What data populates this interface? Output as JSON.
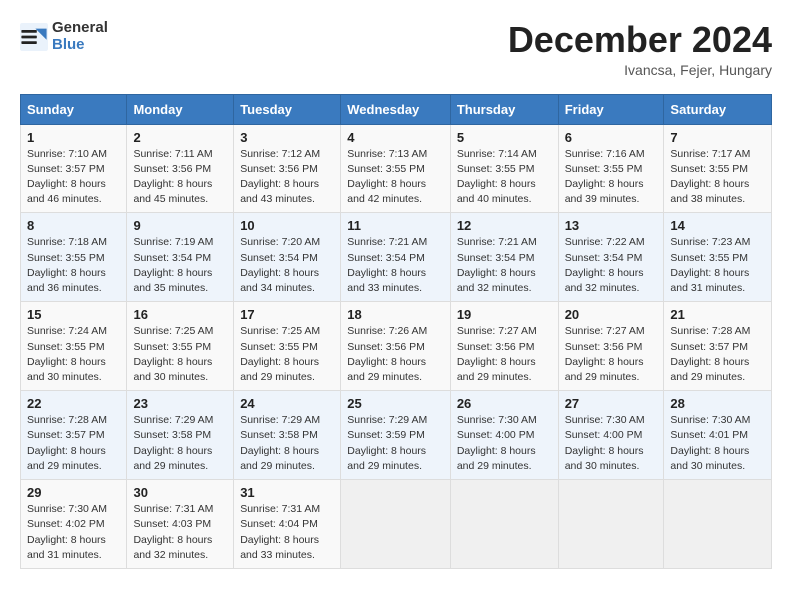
{
  "header": {
    "logo_line1": "General",
    "logo_line2": "Blue",
    "month": "December 2024",
    "location": "Ivancsa, Fejer, Hungary"
  },
  "columns": [
    "Sunday",
    "Monday",
    "Tuesday",
    "Wednesday",
    "Thursday",
    "Friday",
    "Saturday"
  ],
  "weeks": [
    [
      {
        "day": "1",
        "rise": "Sunrise: 7:10 AM",
        "set": "Sunset: 3:57 PM",
        "daylight": "Daylight: 8 hours and 46 minutes."
      },
      {
        "day": "2",
        "rise": "Sunrise: 7:11 AM",
        "set": "Sunset: 3:56 PM",
        "daylight": "Daylight: 8 hours and 45 minutes."
      },
      {
        "day": "3",
        "rise": "Sunrise: 7:12 AM",
        "set": "Sunset: 3:56 PM",
        "daylight": "Daylight: 8 hours and 43 minutes."
      },
      {
        "day": "4",
        "rise": "Sunrise: 7:13 AM",
        "set": "Sunset: 3:55 PM",
        "daylight": "Daylight: 8 hours and 42 minutes."
      },
      {
        "day": "5",
        "rise": "Sunrise: 7:14 AM",
        "set": "Sunset: 3:55 PM",
        "daylight": "Daylight: 8 hours and 40 minutes."
      },
      {
        "day": "6",
        "rise": "Sunrise: 7:16 AM",
        "set": "Sunset: 3:55 PM",
        "daylight": "Daylight: 8 hours and 39 minutes."
      },
      {
        "day": "7",
        "rise": "Sunrise: 7:17 AM",
        "set": "Sunset: 3:55 PM",
        "daylight": "Daylight: 8 hours and 38 minutes."
      }
    ],
    [
      {
        "day": "8",
        "rise": "Sunrise: 7:18 AM",
        "set": "Sunset: 3:55 PM",
        "daylight": "Daylight: 8 hours and 36 minutes."
      },
      {
        "day": "9",
        "rise": "Sunrise: 7:19 AM",
        "set": "Sunset: 3:54 PM",
        "daylight": "Daylight: 8 hours and 35 minutes."
      },
      {
        "day": "10",
        "rise": "Sunrise: 7:20 AM",
        "set": "Sunset: 3:54 PM",
        "daylight": "Daylight: 8 hours and 34 minutes."
      },
      {
        "day": "11",
        "rise": "Sunrise: 7:21 AM",
        "set": "Sunset: 3:54 PM",
        "daylight": "Daylight: 8 hours and 33 minutes."
      },
      {
        "day": "12",
        "rise": "Sunrise: 7:21 AM",
        "set": "Sunset: 3:54 PM",
        "daylight": "Daylight: 8 hours and 32 minutes."
      },
      {
        "day": "13",
        "rise": "Sunrise: 7:22 AM",
        "set": "Sunset: 3:54 PM",
        "daylight": "Daylight: 8 hours and 32 minutes."
      },
      {
        "day": "14",
        "rise": "Sunrise: 7:23 AM",
        "set": "Sunset: 3:55 PM",
        "daylight": "Daylight: 8 hours and 31 minutes."
      }
    ],
    [
      {
        "day": "15",
        "rise": "Sunrise: 7:24 AM",
        "set": "Sunset: 3:55 PM",
        "daylight": "Daylight: 8 hours and 30 minutes."
      },
      {
        "day": "16",
        "rise": "Sunrise: 7:25 AM",
        "set": "Sunset: 3:55 PM",
        "daylight": "Daylight: 8 hours and 30 minutes."
      },
      {
        "day": "17",
        "rise": "Sunrise: 7:25 AM",
        "set": "Sunset: 3:55 PM",
        "daylight": "Daylight: 8 hours and 29 minutes."
      },
      {
        "day": "18",
        "rise": "Sunrise: 7:26 AM",
        "set": "Sunset: 3:56 PM",
        "daylight": "Daylight: 8 hours and 29 minutes."
      },
      {
        "day": "19",
        "rise": "Sunrise: 7:27 AM",
        "set": "Sunset: 3:56 PM",
        "daylight": "Daylight: 8 hours and 29 minutes."
      },
      {
        "day": "20",
        "rise": "Sunrise: 7:27 AM",
        "set": "Sunset: 3:56 PM",
        "daylight": "Daylight: 8 hours and 29 minutes."
      },
      {
        "day": "21",
        "rise": "Sunrise: 7:28 AM",
        "set": "Sunset: 3:57 PM",
        "daylight": "Daylight: 8 hours and 29 minutes."
      }
    ],
    [
      {
        "day": "22",
        "rise": "Sunrise: 7:28 AM",
        "set": "Sunset: 3:57 PM",
        "daylight": "Daylight: 8 hours and 29 minutes."
      },
      {
        "day": "23",
        "rise": "Sunrise: 7:29 AM",
        "set": "Sunset: 3:58 PM",
        "daylight": "Daylight: 8 hours and 29 minutes."
      },
      {
        "day": "24",
        "rise": "Sunrise: 7:29 AM",
        "set": "Sunset: 3:58 PM",
        "daylight": "Daylight: 8 hours and 29 minutes."
      },
      {
        "day": "25",
        "rise": "Sunrise: 7:29 AM",
        "set": "Sunset: 3:59 PM",
        "daylight": "Daylight: 8 hours and 29 minutes."
      },
      {
        "day": "26",
        "rise": "Sunrise: 7:30 AM",
        "set": "Sunset: 4:00 PM",
        "daylight": "Daylight: 8 hours and 29 minutes."
      },
      {
        "day": "27",
        "rise": "Sunrise: 7:30 AM",
        "set": "Sunset: 4:00 PM",
        "daylight": "Daylight: 8 hours and 30 minutes."
      },
      {
        "day": "28",
        "rise": "Sunrise: 7:30 AM",
        "set": "Sunset: 4:01 PM",
        "daylight": "Daylight: 8 hours and 30 minutes."
      }
    ],
    [
      {
        "day": "29",
        "rise": "Sunrise: 7:30 AM",
        "set": "Sunset: 4:02 PM",
        "daylight": "Daylight: 8 hours and 31 minutes."
      },
      {
        "day": "30",
        "rise": "Sunrise: 7:31 AM",
        "set": "Sunset: 4:03 PM",
        "daylight": "Daylight: 8 hours and 32 minutes."
      },
      {
        "day": "31",
        "rise": "Sunrise: 7:31 AM",
        "set": "Sunset: 4:04 PM",
        "daylight": "Daylight: 8 hours and 33 minutes."
      },
      null,
      null,
      null,
      null
    ]
  ]
}
